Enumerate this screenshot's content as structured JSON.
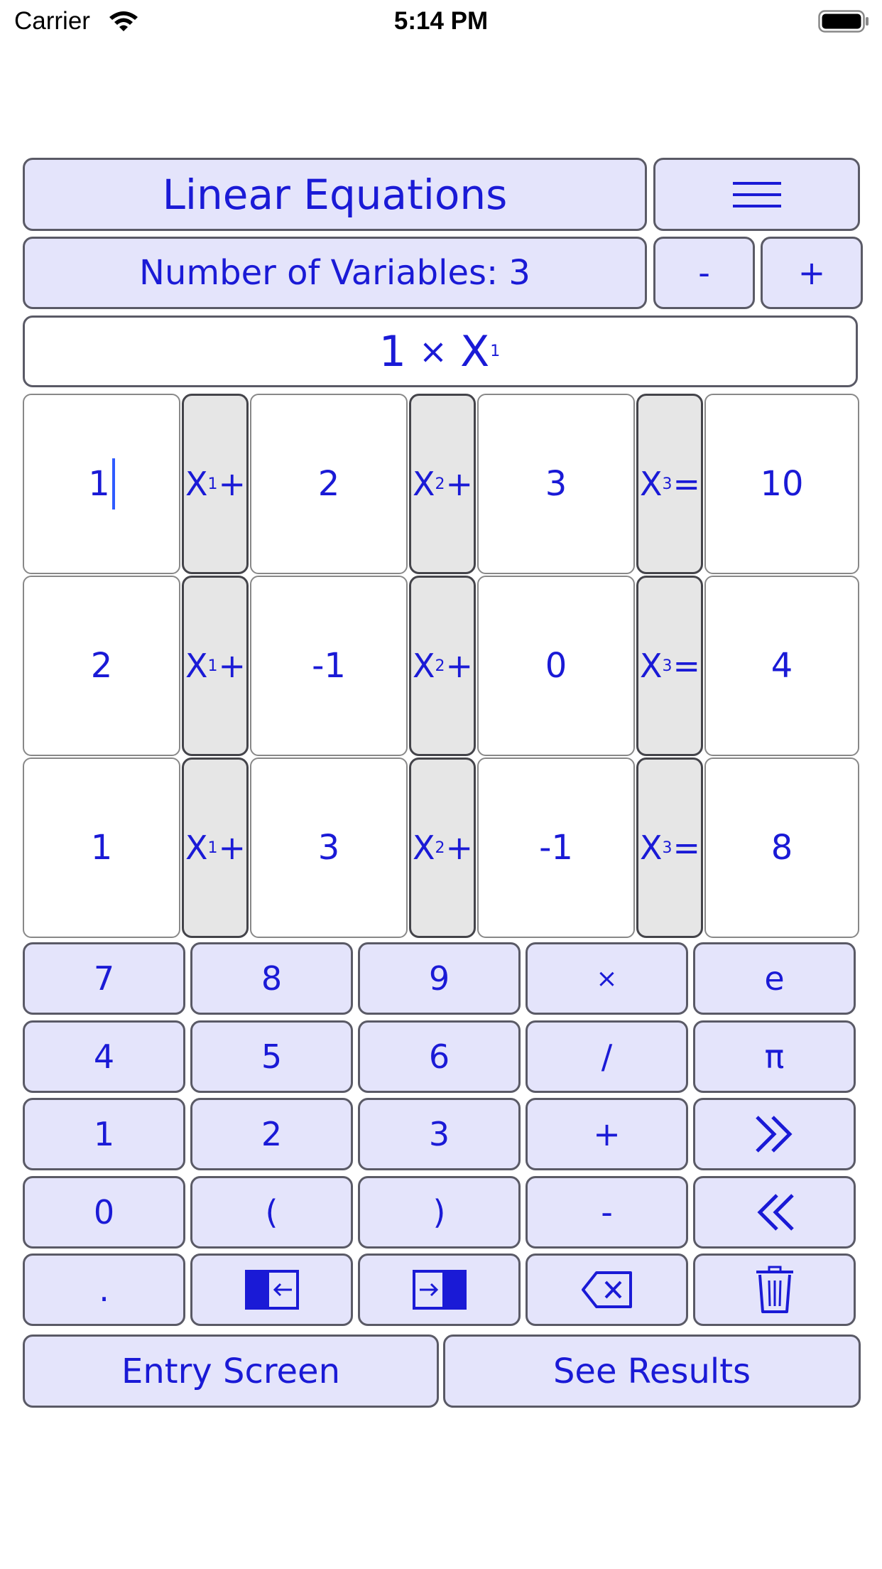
{
  "status_bar": {
    "carrier": "Carrier",
    "time": "5:14 PM"
  },
  "header": {
    "title": "Linear Equations",
    "menu_icon": "hamburger-menu-icon"
  },
  "variables": {
    "label": "Number of Variables: 3",
    "decrement_label": "-",
    "increment_label": "+"
  },
  "display": {
    "coefficient": "1",
    "operator": "×",
    "variable": "X",
    "subscript": "1"
  },
  "equations": [
    {
      "coefficients": [
        "1",
        "2",
        "3"
      ],
      "result": "10"
    },
    {
      "coefficients": [
        "2",
        "-1",
        "0"
      ],
      "result": "4"
    },
    {
      "coefficients": [
        "1",
        "3",
        "-1"
      ],
      "result": "8"
    }
  ],
  "variable_labels": [
    {
      "name": "X",
      "sub": "1",
      "op": "+"
    },
    {
      "name": "X",
      "sub": "2",
      "op": "+"
    },
    {
      "name": "X",
      "sub": "3",
      "op": "="
    }
  ],
  "keypad": {
    "row1": [
      "7",
      "8",
      "9",
      "×",
      "e"
    ],
    "row2": [
      "4",
      "5",
      "6",
      "/",
      "π"
    ],
    "row3": [
      "1",
      "2",
      "3",
      "+"
    ],
    "row4": [
      "0",
      "(",
      ")",
      "-"
    ],
    "row5": [
      "."
    ],
    "icons": {
      "next": "double-chevron-right-icon",
      "prev": "double-chevron-left-icon",
      "move_left": "move-left-icon",
      "move_right": "move-right-icon",
      "backspace": "backspace-icon",
      "clear": "trash-icon"
    }
  },
  "footer": {
    "entry_label": "Entry Screen",
    "results_label": "See Results"
  },
  "colors": {
    "accent": "#1a1ad6",
    "button_bg": "#e4e4fb",
    "variable_bg": "#e6e6e6",
    "caret": "#2f5bff"
  }
}
